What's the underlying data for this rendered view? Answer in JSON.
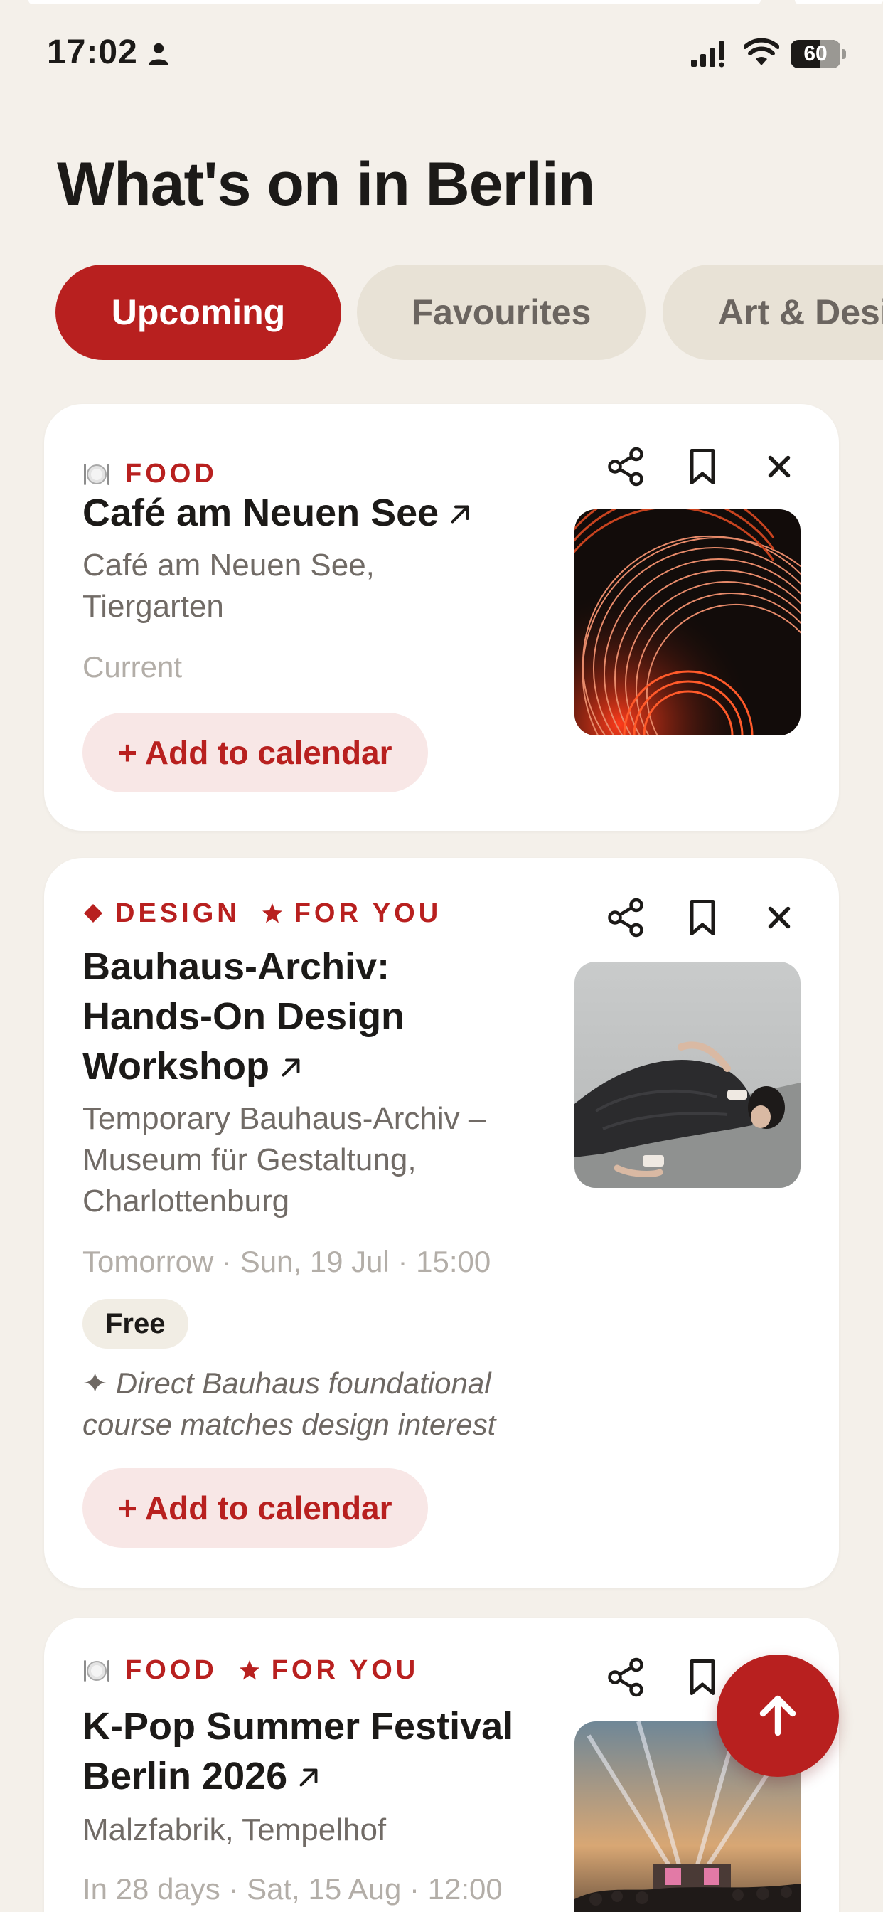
{
  "status_bar": {
    "time": "17:02",
    "battery": "60",
    "battery_level": 0.6
  },
  "page": {
    "title": "What's on in Berlin"
  },
  "tabs": [
    {
      "label": "Upcoming",
      "active": true
    },
    {
      "label": "Favourites",
      "active": false
    },
    {
      "label": "Art & Desi",
      "active": false
    }
  ],
  "events": [
    {
      "categories": [
        {
          "icon": "plate-cutlery-icon",
          "label": "FOOD"
        }
      ],
      "title": "Café am Neuen See",
      "venue_lines": [
        "Café am Neuen See,",
        "Tiergarten"
      ],
      "when": "Current",
      "cta": "+ Add to calendar"
    },
    {
      "categories": [
        {
          "icon": "diamond-icon",
          "label": "DESIGN"
        },
        {
          "icon": "star-icon",
          "label": "FOR YOU"
        }
      ],
      "title_lines": [
        "Bauhaus-Archiv:",
        "Hands-On Design",
        "Workshop"
      ],
      "venue_lines": [
        "Temporary Bauhaus-Archiv –",
        "Museum für Gestaltung,",
        "Charlottenburg"
      ],
      "when": "Tomorrow · Sun, 19 Jul · 15:00",
      "price": "Free",
      "reason_lines": [
        "✦ Direct Bauhaus foundational",
        "course matches design interest"
      ],
      "cta": "+ Add to calendar"
    },
    {
      "categories": [
        {
          "icon": "plate-cutlery-icon",
          "label": "FOOD"
        },
        {
          "icon": "star-icon",
          "label": "FOR YOU"
        }
      ],
      "title_lines": [
        "K-Pop Summer Festival",
        "Berlin 2026"
      ],
      "venue_lines": [
        "Malzfabrik, Tempelhof"
      ],
      "when": "In 28 days · Sat, 15 Aug · 12:00"
    }
  ],
  "colors": {
    "accent": "#b8201f",
    "background": "#f4f0ea",
    "card": "#ffffff"
  }
}
